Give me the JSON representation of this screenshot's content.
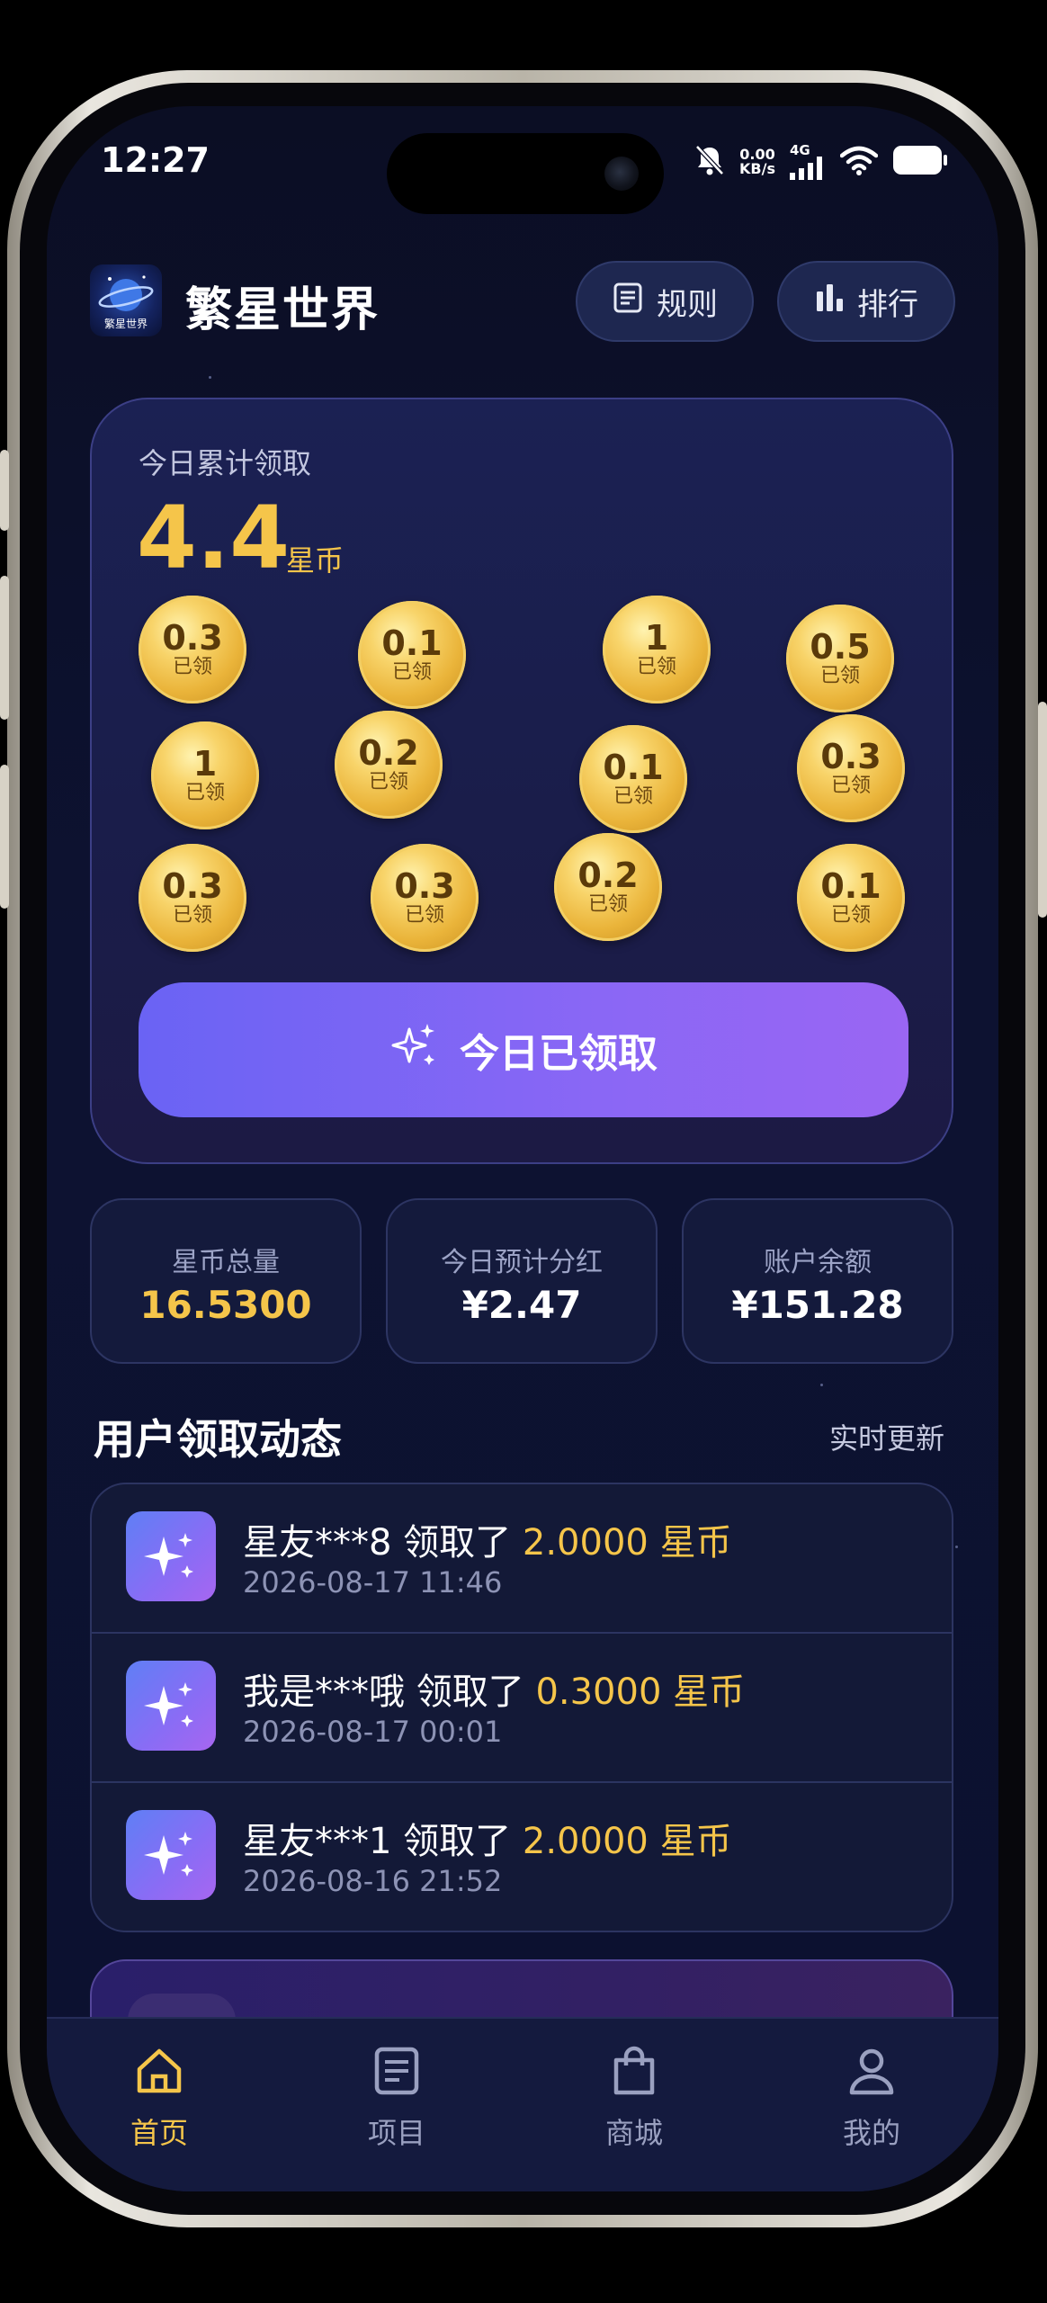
{
  "status_bar": {
    "time": "12:27",
    "net_speed_value": "0.00",
    "net_speed_unit": "KB/s",
    "network_type": "4G",
    "icons": [
      "bell-muted-icon",
      "signal-icon",
      "wifi-icon",
      "battery-icon"
    ]
  },
  "header": {
    "logo_text": "繁星世界",
    "title": "繁星世界",
    "rules_label": "规则",
    "ranking_label": "排行"
  },
  "today": {
    "label": "今日累计领取",
    "amount": "4.4",
    "unit": "星币",
    "coins": [
      {
        "value": "0.3",
        "status": "已领"
      },
      {
        "value": "0.1",
        "status": "已领"
      },
      {
        "value": "1",
        "status": "已领"
      },
      {
        "value": "0.5",
        "status": "已领"
      },
      {
        "value": "1",
        "status": "已领"
      },
      {
        "value": "0.2",
        "status": "已领"
      },
      {
        "value": "0.1",
        "status": "已领"
      },
      {
        "value": "0.3",
        "status": "已领"
      },
      {
        "value": "0.3",
        "status": "已领"
      },
      {
        "value": "0.3",
        "status": "已领"
      },
      {
        "value": "0.2",
        "status": "已领"
      },
      {
        "value": "0.1",
        "status": "已领"
      }
    ],
    "claim_button_label": "今日已领取"
  },
  "stats": [
    {
      "label": "星币总量",
      "value": "16.5300"
    },
    {
      "label": "今日预计分红",
      "value": "¥2.47"
    },
    {
      "label": "账户余额",
      "value": "¥151.28"
    }
  ],
  "feed": {
    "title": "用户领取动态",
    "side_label": "实时更新",
    "items": [
      {
        "user": "星友***8",
        "action": "领取了",
        "amount": "2.0000 星币",
        "time": "2026-08-17 11:46"
      },
      {
        "user": "我是***哦",
        "action": "领取了",
        "amount": "0.3000 星币",
        "time": "2026-08-17 00:01"
      },
      {
        "user": "星友***1",
        "action": "领取了",
        "amount": "2.0000 星币",
        "time": "2026-08-16 21:52"
      }
    ]
  },
  "tabbar": {
    "items": [
      {
        "label": "首页",
        "icon": "home-icon"
      },
      {
        "label": "项目",
        "icon": "document-icon"
      },
      {
        "label": "商城",
        "icon": "shopping-bag-icon"
      },
      {
        "label": "我的",
        "icon": "user-icon"
      }
    ],
    "active_color": "#f5c54a",
    "inactive_color": "#9aa0c0"
  },
  "colors": {
    "accent_gold": "#f5c54a",
    "button_purple": "#7c66f5",
    "background": "#0c1130"
  }
}
